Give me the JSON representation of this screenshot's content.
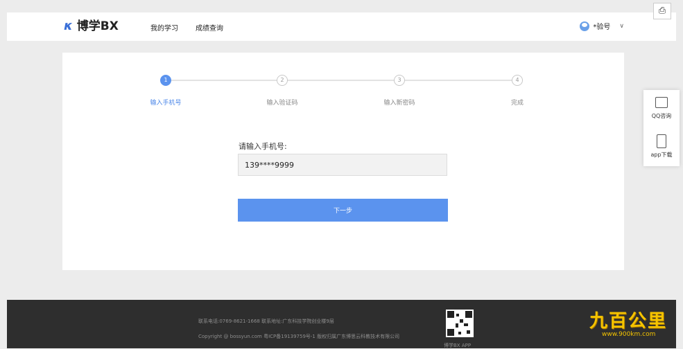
{
  "header": {
    "logo_mark": "𝞳",
    "logo_text": "博学BX",
    "nav": [
      "我的学习",
      "成绩查询"
    ],
    "user_name": "*验号",
    "chevron": "∨"
  },
  "print_icon": "⎙",
  "steps": [
    {
      "number": "1",
      "label": "输入手机号",
      "active": true
    },
    {
      "number": "2",
      "label": "输入验证码",
      "active": false
    },
    {
      "number": "3",
      "label": "输入新密码",
      "active": false
    },
    {
      "number": "4",
      "label": "完成",
      "active": false
    }
  ],
  "form": {
    "label": "请输入手机号:",
    "phone_value": "139****9999",
    "next_label": "下一步"
  },
  "side_widget": {
    "qq_label": "QQ咨询",
    "app_label": "app下载"
  },
  "footer": {
    "line1": "联系电话:0769-8621-1668    联系地址:广东科技学院创业楼9层",
    "line2": "Copyright @ bossyun.com 粤ICP备19139759号-1    版权归属广东博思云科教技术有限公司",
    "app_label": "博学BX APP"
  },
  "watermark": {
    "main": "九百公里",
    "sub": "www.900km.com"
  },
  "colors": {
    "accent": "#5b93ee",
    "footer_bg": "#2e2e2e",
    "page_bg": "#ececec"
  }
}
